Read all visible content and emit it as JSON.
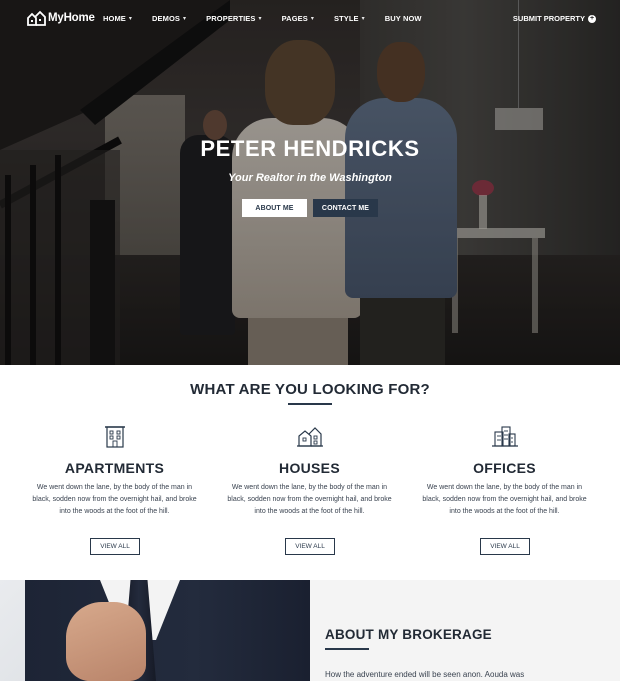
{
  "brand": {
    "name": "MyHome"
  },
  "nav": {
    "items": [
      {
        "label": "HOME",
        "has_dropdown": true
      },
      {
        "label": "DEMOS",
        "has_dropdown": true
      },
      {
        "label": "PROPERTIES",
        "has_dropdown": true
      },
      {
        "label": "PAGES",
        "has_dropdown": true
      },
      {
        "label": "STYLE",
        "has_dropdown": true
      },
      {
        "label": "BUY NOW",
        "has_dropdown": false
      }
    ],
    "caret": "▾",
    "submit_label": "SUBMIT PROPERTY",
    "submit_icon": "plus-circle-icon"
  },
  "hero": {
    "title": "PETER HENDRICKS",
    "subtitle": "Your Realtor in the Washington",
    "about_button": "ABOUT ME",
    "contact_button": "CONTACT ME"
  },
  "looking_for": {
    "title": "WHAT ARE YOU LOOKING FOR?",
    "categories": [
      {
        "icon": "apartment-building-icon",
        "title": "APARTMENTS",
        "text": "We went down the lane, by the body of the man in black, sodden now from the overnight hail, and broke into the woods at the foot of the hill.",
        "button": "VIEW ALL"
      },
      {
        "icon": "houses-icon",
        "title": "HOUSES",
        "text": "We went down the lane, by the body of the man in black, sodden now from the overnight hail, and broke into the woods at the foot of the hill.",
        "button": "VIEW ALL"
      },
      {
        "icon": "office-buildings-icon",
        "title": "OFFICES",
        "text": "We went down the lane, by the body of the man in black, sodden now from the overnight hail, and broke into the woods at the foot of the hill.",
        "button": "VIEW ALL"
      }
    ]
  },
  "brokerage": {
    "title": "ABOUT MY BROKERAGE",
    "text": "How the adventure ended will be seen anon. Aouda was"
  },
  "colors": {
    "accent": "#29384a",
    "panel_bg": "#f4f4f4",
    "text_dark": "#222a35"
  }
}
